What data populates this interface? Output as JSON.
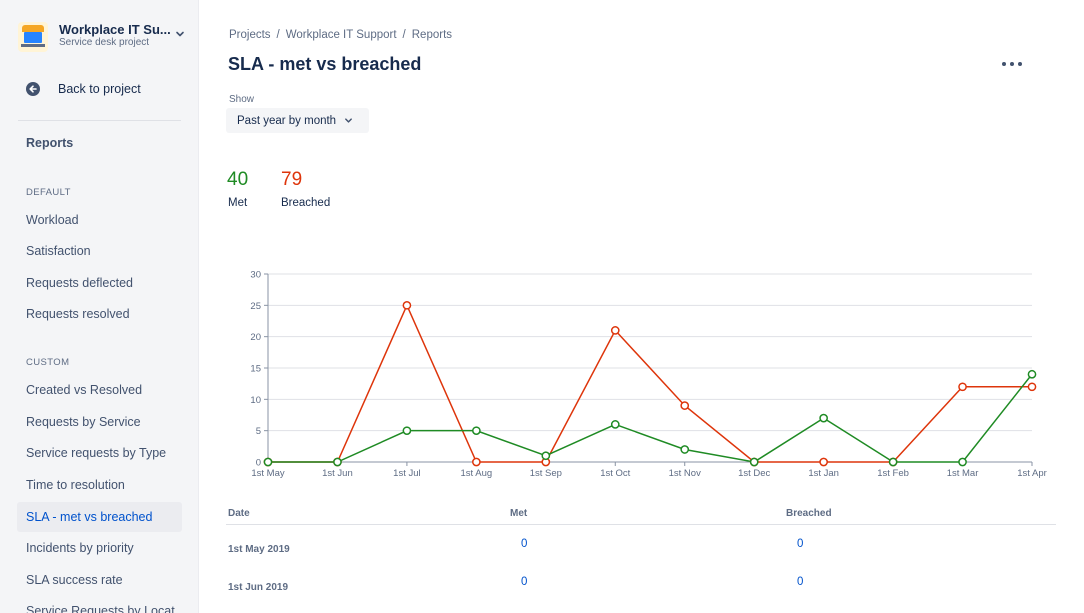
{
  "sidebar": {
    "project_name": "Workplace IT Su...",
    "project_type": "Service desk project",
    "back_label": "Back to project",
    "reports_label": "Reports",
    "default_section": "DEFAULT",
    "default_items": [
      "Workload",
      "Satisfaction",
      "Requests deflected",
      "Requests resolved"
    ],
    "custom_section": "CUSTOM",
    "custom_items": [
      "Created vs Resolved",
      "Requests by Service",
      "Service requests by Type",
      "Time to resolution",
      "SLA - met vs breached",
      "Incidents by priority",
      "SLA success rate",
      "Service Requests by Locat..."
    ],
    "active_item": "SLA - met vs breached"
  },
  "breadcrumb": [
    "Projects",
    "Workplace IT Support",
    "Reports"
  ],
  "breadcrumb_sep": "/",
  "title": "SLA - met vs breached",
  "show": {
    "label": "Show",
    "value": "Past year by month"
  },
  "stats": {
    "met_value": "40",
    "met_label": "Met",
    "breached_value": "79",
    "breached_label": "Breached"
  },
  "colors": {
    "met": "#1f8b24",
    "breached": "#de350b",
    "link": "#0052cc"
  },
  "chart_data": {
    "type": "line",
    "x": [
      "1st May",
      "1st Jun",
      "1st Jul",
      "1st Aug",
      "1st Sep",
      "1st Oct",
      "1st Nov",
      "1st Dec",
      "1st Jan",
      "1st Feb",
      "1st Mar",
      "1st Apr"
    ],
    "series": [
      {
        "name": "Met",
        "values": [
          0,
          0,
          5,
          5,
          1,
          6,
          2,
          0,
          7,
          0,
          0,
          14
        ]
      },
      {
        "name": "Breached",
        "values": [
          0,
          0,
          25,
          0,
          0,
          21,
          9,
          0,
          0,
          0,
          12,
          12
        ]
      }
    ],
    "ylim": [
      0,
      30
    ],
    "yticks": [
      0,
      5,
      10,
      15,
      20,
      25,
      30
    ],
    "grid": true
  },
  "table": {
    "headers": {
      "date": "Date",
      "met": "Met",
      "breached": "Breached"
    },
    "rows": [
      {
        "date": "1st May 2019",
        "met": "0",
        "breached": "0"
      },
      {
        "date": "1st Jun 2019",
        "met": "0",
        "breached": "0"
      }
    ]
  }
}
